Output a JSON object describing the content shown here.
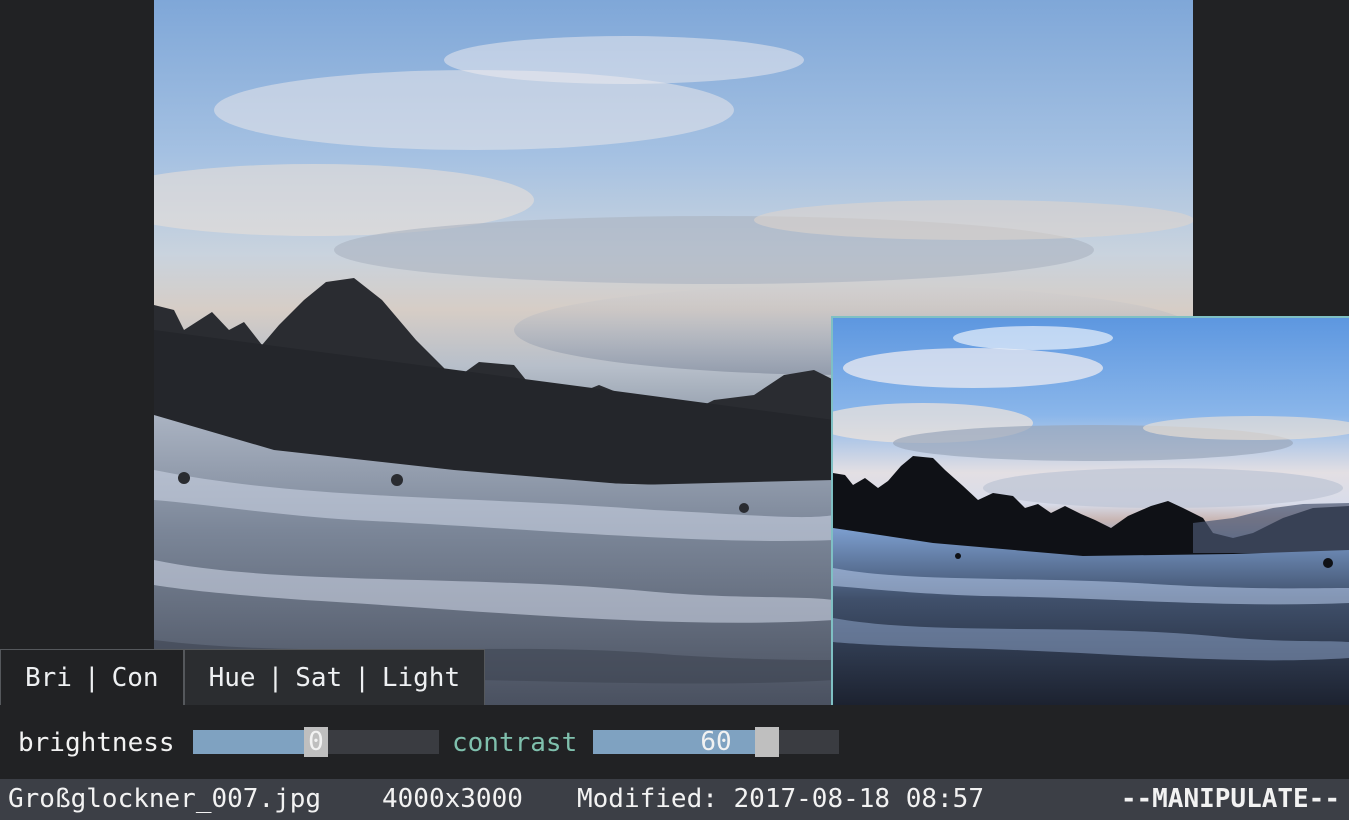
{
  "image": {
    "subject": "glacier-mountain-landscape"
  },
  "tabs": [
    {
      "parts": [
        "Bri",
        "Con"
      ],
      "active": true
    },
    {
      "parts": [
        "Hue",
        "Sat",
        "Light"
      ],
      "active": false
    }
  ],
  "sliders": {
    "brightness": {
      "label": "brightness",
      "value": "0",
      "fill_fraction": 0.5
    },
    "contrast": {
      "label": "contrast",
      "value": "60",
      "fill_fraction": 0.7
    }
  },
  "statusbar": {
    "filename": "Großglockner_007.jpg",
    "dimensions": "4000x3000",
    "modified": "Modified: 2017-08-18 08:57",
    "mode": "--MANIPULATE--"
  },
  "colors": {
    "background": "#212224",
    "statusbar": "#3c3f46",
    "slider_fill": "#7fa2c1",
    "slider_handle": "#bfbfbf",
    "inactive_label": "#7fc0ad",
    "preview_border": "#7fc0c4"
  }
}
